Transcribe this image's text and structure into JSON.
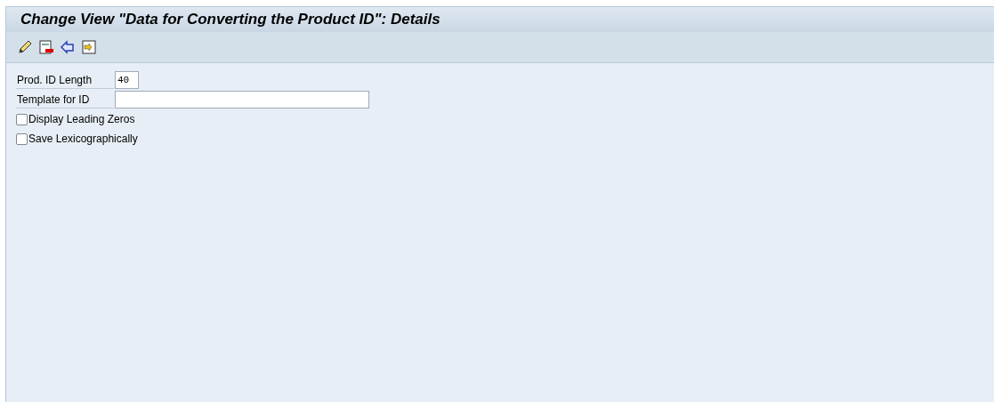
{
  "window": {
    "title": "Change View \"Data for Converting the Product ID\": Details"
  },
  "fields": [
    {
      "label": "Prod. ID Length",
      "value": "40"
    },
    {
      "label": "Template for ID"
    }
  ],
  "checkboxes": [
    {
      "label": "Display Leading Zeros",
      "checked": false
    },
    {
      "label": "Save Lexicographically",
      "checked": false
    }
  ]
}
